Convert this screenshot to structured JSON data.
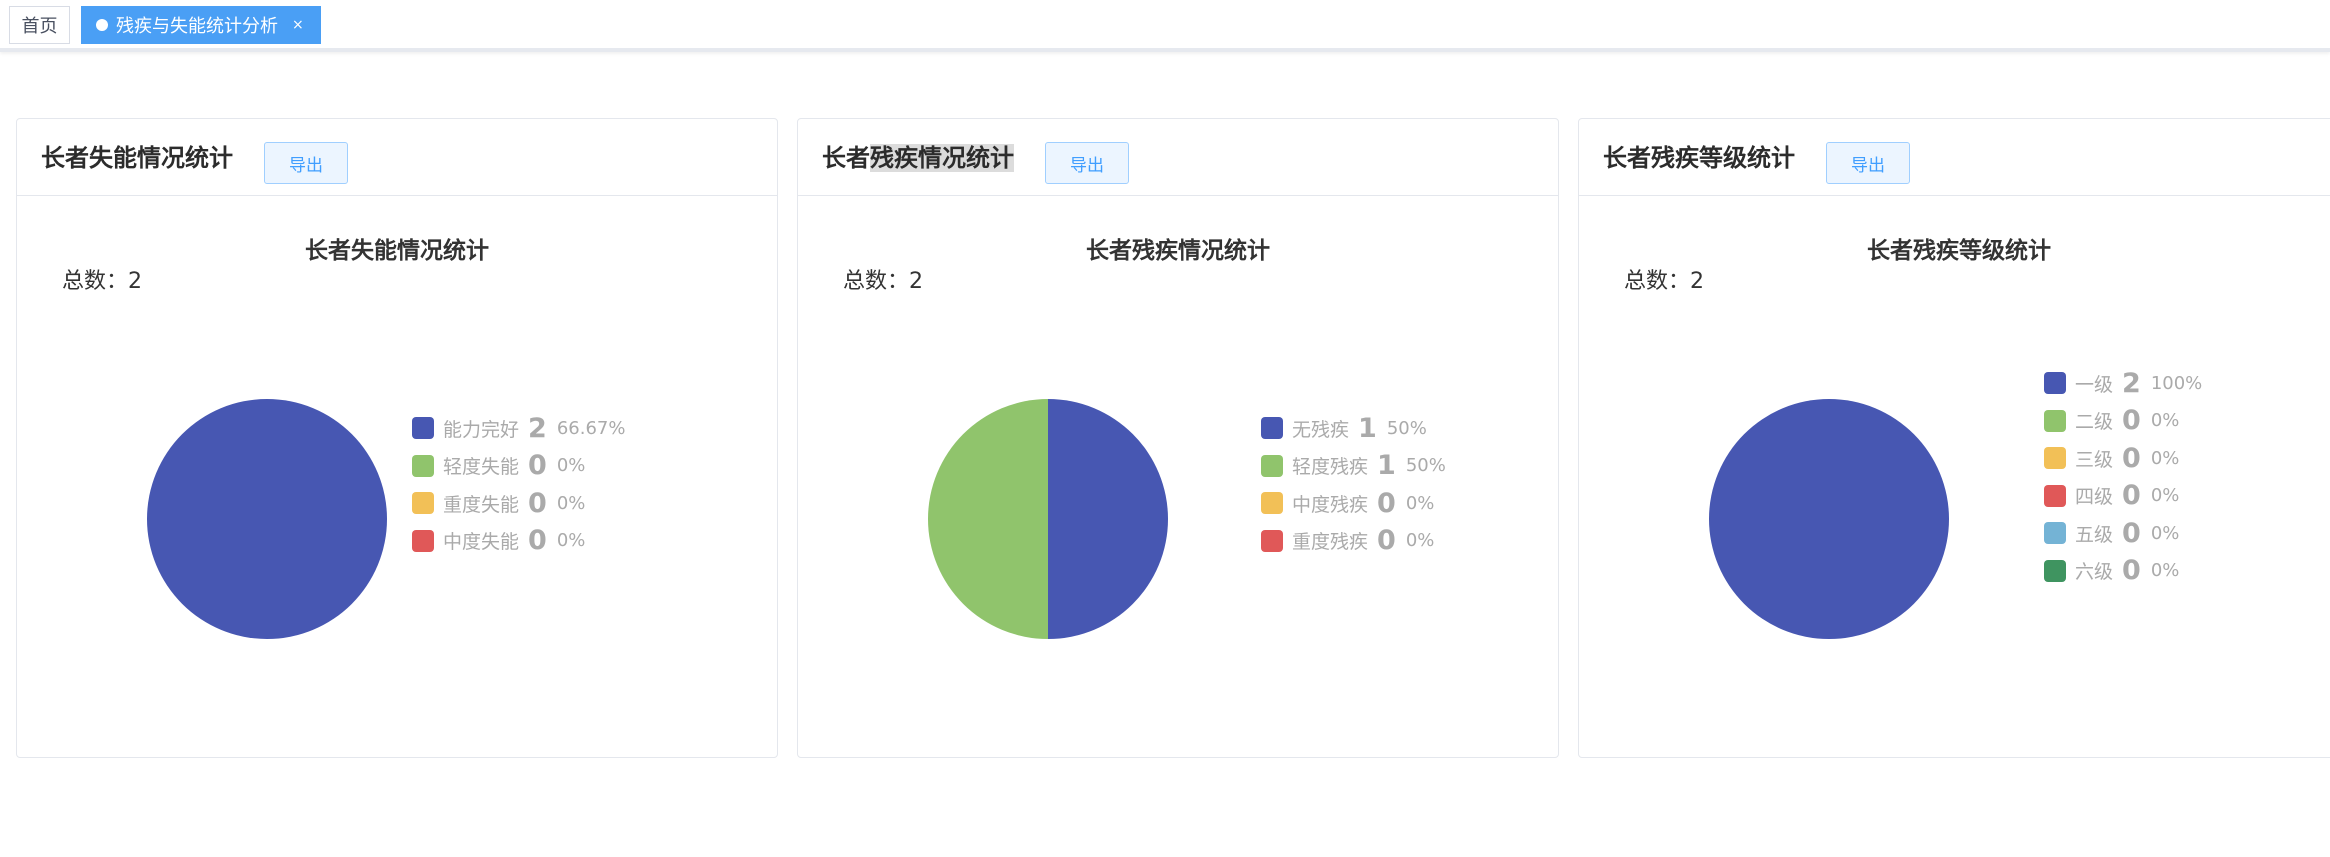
{
  "tabs": {
    "home": "首页",
    "active": "残疾与失能统计分析",
    "close": "×"
  },
  "export_label": "导出",
  "chart_data": [
    {
      "type": "pie",
      "panel_title": "长者失能情况统计",
      "title": "长者失能情况统计",
      "total_text": "总数：2",
      "total": 2,
      "slices": [
        {
          "label": "能力完好",
          "value": 2,
          "percent": "66.67%",
          "color": "#4757b2"
        },
        {
          "label": "轻度失能",
          "value": 0,
          "percent": "0%",
          "color": "#90c46c"
        },
        {
          "label": "重度失能",
          "value": 0,
          "percent": "0%",
          "color": "#f2c057"
        },
        {
          "label": "中度失能",
          "value": 0,
          "percent": "0%",
          "color": "#e05858"
        }
      ]
    },
    {
      "type": "pie",
      "panel_title": "长者残疾情况统计",
      "title": "长者残疾情况统计",
      "total_text": "总数：2",
      "total": 2,
      "slices": [
        {
          "label": "无残疾",
          "value": 1,
          "percent": "50%",
          "color": "#4757b2"
        },
        {
          "label": "轻度残疾",
          "value": 1,
          "percent": "50%",
          "color": "#90c46c"
        },
        {
          "label": "中度残疾",
          "value": 0,
          "percent": "0%",
          "color": "#f2c057"
        },
        {
          "label": "重度残疾",
          "value": 0,
          "percent": "0%",
          "color": "#e05858"
        }
      ]
    },
    {
      "type": "pie",
      "panel_title": "长者残疾等级统计",
      "title": "长者残疾等级统计",
      "total_text": "总数：2",
      "total": 2,
      "slices": [
        {
          "label": "一级",
          "value": 2,
          "percent": "100%",
          "color": "#4757b2"
        },
        {
          "label": "二级",
          "value": 0,
          "percent": "0%",
          "color": "#90c46c"
        },
        {
          "label": "三级",
          "value": 0,
          "percent": "0%",
          "color": "#f2c057"
        },
        {
          "label": "四级",
          "value": 0,
          "percent": "0%",
          "color": "#e05858"
        },
        {
          "label": "五级",
          "value": 0,
          "percent": "0%",
          "color": "#74b3d5"
        },
        {
          "label": "六级",
          "value": 0,
          "percent": "0%",
          "color": "#3f9460"
        }
      ]
    }
  ]
}
